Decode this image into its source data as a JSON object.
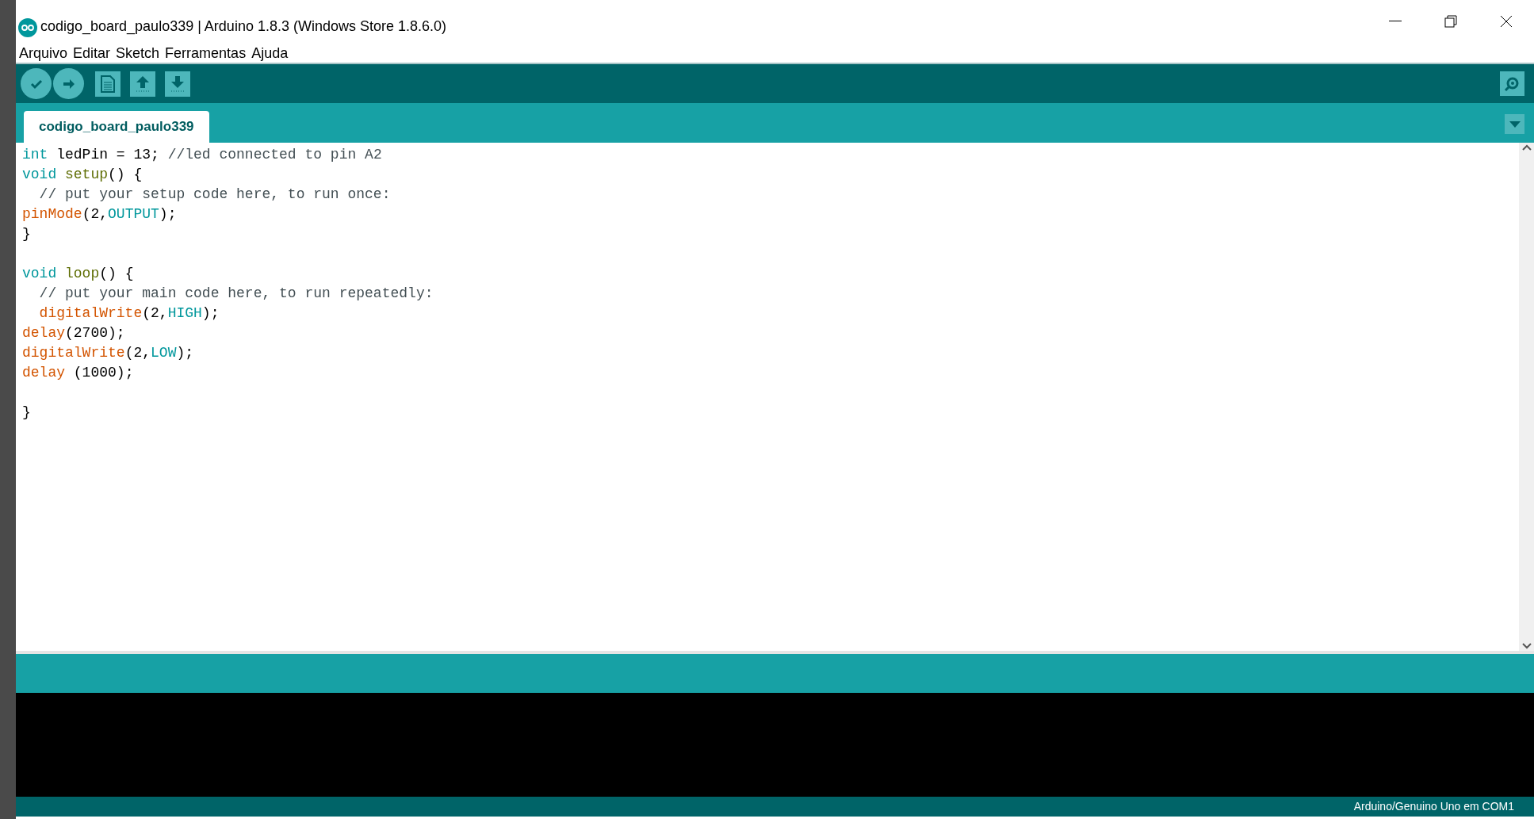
{
  "window": {
    "title": "codigo_board_paulo339 | Arduino 1.8.3 (Windows Store 1.8.6.0)"
  },
  "menu": [
    "Arquivo",
    "Editar",
    "Sketch",
    "Ferramentas",
    "Ajuda"
  ],
  "tabs": [
    {
      "label": "codigo_board_paulo339",
      "selected": true
    }
  ],
  "code": [
    {
      "kind": "code",
      "tokens": [
        {
          "text": "int",
          "kind": "keyword"
        },
        {
          "text": " ledPin = 13; ",
          "kind": "plain"
        },
        {
          "text": "//led connected to pin A2",
          "kind": "comment"
        }
      ]
    },
    {
      "kind": "code",
      "tokens": [
        {
          "text": "void",
          "kind": "keyword"
        },
        {
          "text": " setup",
          "kind": "function"
        },
        {
          "text": "() {",
          "kind": "plain"
        }
      ]
    },
    {
      "kind": "code",
      "tokens": [
        {
          "text": "  // put your setup code here, to run once:",
          "kind": "comment"
        }
      ]
    },
    {
      "kind": "code",
      "tokens": [
        {
          "text": "pinMode",
          "kind": "builtin"
        },
        {
          "text": "(2,",
          "kind": "plain"
        },
        {
          "text": "OUTPUT",
          "kind": "constant"
        },
        {
          "text": ");",
          "kind": "plain"
        }
      ]
    },
    {
      "kind": "code",
      "tokens": [
        {
          "text": "}",
          "kind": "plain"
        }
      ]
    },
    {
      "kind": "blank"
    },
    {
      "kind": "code",
      "tokens": [
        {
          "text": "void",
          "kind": "keyword"
        },
        {
          "text": " loop",
          "kind": "function"
        },
        {
          "text": "() {",
          "kind": "plain"
        }
      ]
    },
    {
      "kind": "code",
      "tokens": [
        {
          "text": "  // put your main code here, to run repeatedly:",
          "kind": "comment"
        }
      ]
    },
    {
      "kind": "code",
      "tokens": [
        {
          "text": "  digitalWrite",
          "kind": "builtin"
        },
        {
          "text": "(2,",
          "kind": "plain"
        },
        {
          "text": "HIGH",
          "kind": "constant"
        },
        {
          "text": ");",
          "kind": "plain"
        }
      ]
    },
    {
      "kind": "code",
      "tokens": [
        {
          "text": "delay",
          "kind": "builtin"
        },
        {
          "text": "(2700);",
          "kind": "plain"
        }
      ]
    },
    {
      "kind": "code",
      "tokens": [
        {
          "text": "digitalWrite",
          "kind": "builtin"
        },
        {
          "text": "(2,",
          "kind": "plain"
        },
        {
          "text": "LOW",
          "kind": "constant"
        },
        {
          "text": ");",
          "kind": "plain"
        }
      ]
    },
    {
      "kind": "code",
      "tokens": [
        {
          "text": "delay",
          "kind": "builtin"
        },
        {
          "text": " (1000);",
          "kind": "plain"
        }
      ]
    },
    {
      "kind": "blank"
    },
    {
      "kind": "code",
      "tokens": [
        {
          "text": "}",
          "kind": "plain"
        }
      ]
    }
  ],
  "status_bar": {
    "board": "Arduino/Genuino Uno em COM1"
  }
}
